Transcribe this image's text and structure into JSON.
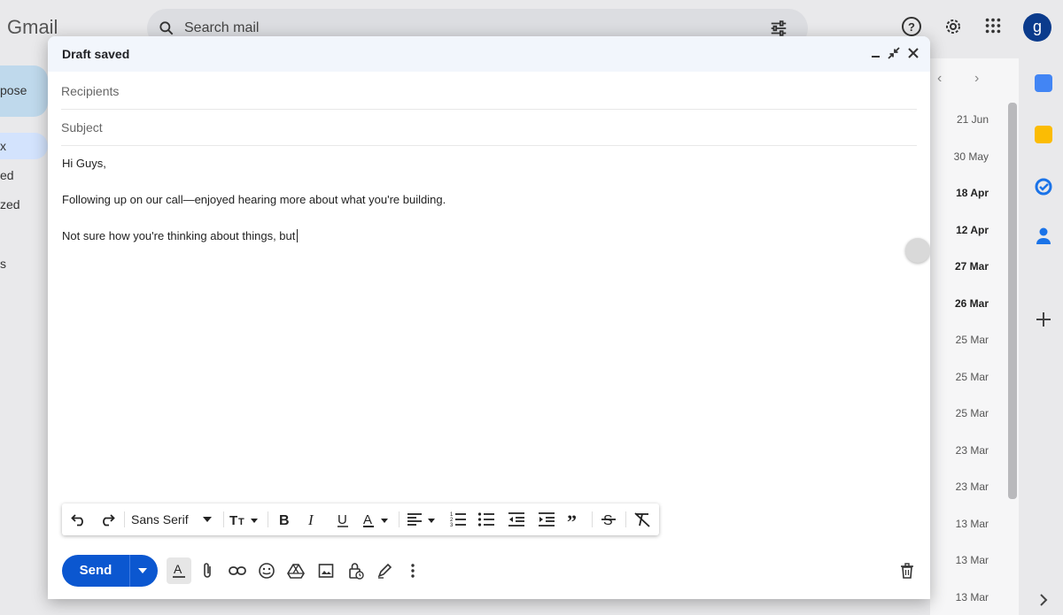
{
  "app": {
    "logo": "Gmail"
  },
  "search": {
    "placeholder": "Search mail"
  },
  "avatar_letter": "g",
  "compose_button": {
    "label": "pose"
  },
  "left_nav": [
    "x",
    "ed",
    "zed",
    "s"
  ],
  "dates": [
    {
      "text": "21 Jun",
      "bold": false
    },
    {
      "text": "30 May",
      "bold": false
    },
    {
      "text": "18 Apr",
      "bold": true
    },
    {
      "text": "12 Apr",
      "bold": true
    },
    {
      "text": "27 Mar",
      "bold": true
    },
    {
      "text": "26 Mar",
      "bold": true
    },
    {
      "text": "25 Mar",
      "bold": false
    },
    {
      "text": "25 Mar",
      "bold": false
    },
    {
      "text": "25 Mar",
      "bold": false
    },
    {
      "text": "23 Mar",
      "bold": false
    },
    {
      "text": "23 Mar",
      "bold": false
    },
    {
      "text": "13 Mar",
      "bold": false
    },
    {
      "text": "13 Mar",
      "bold": false
    },
    {
      "text": "13 Mar",
      "bold": false
    }
  ],
  "compose": {
    "title": "Draft saved",
    "recipients_placeholder": "Recipients",
    "subject_placeholder": "Subject",
    "body": [
      "Hi Guys,",
      "Following up on our call—enjoyed hearing more about what you're building.",
      "Not sure how you're thinking about things, but"
    ]
  },
  "toolbar": {
    "font": "Sans Serif"
  },
  "send": {
    "label": "Send"
  },
  "colors": {
    "send_blue": "#0b57d0",
    "header_bg": "#f2f6fc"
  }
}
